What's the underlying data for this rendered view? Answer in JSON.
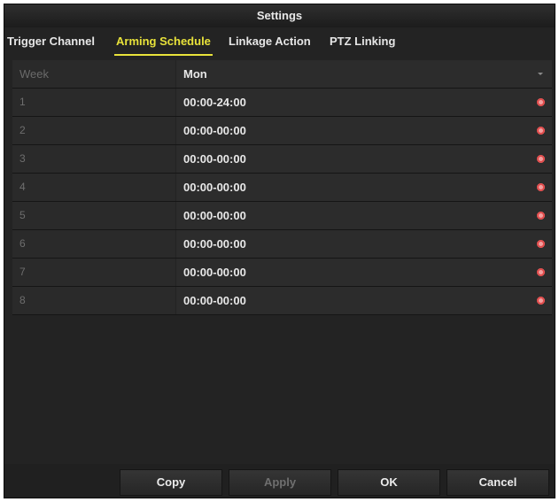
{
  "dialog": {
    "title": "Settings"
  },
  "tabs": [
    {
      "label": "Trigger Channel",
      "active": false
    },
    {
      "label": "Arming Schedule",
      "active": true
    },
    {
      "label": "Linkage Action",
      "active": false
    },
    {
      "label": "PTZ Linking",
      "active": false
    }
  ],
  "schedule": {
    "week_label": "Week",
    "week_value": "Mon",
    "rows": [
      {
        "index": "1",
        "time": "00:00-24:00"
      },
      {
        "index": "2",
        "time": "00:00-00:00"
      },
      {
        "index": "3",
        "time": "00:00-00:00"
      },
      {
        "index": "4",
        "time": "00:00-00:00"
      },
      {
        "index": "5",
        "time": "00:00-00:00"
      },
      {
        "index": "6",
        "time": "00:00-00:00"
      },
      {
        "index": "7",
        "time": "00:00-00:00"
      },
      {
        "index": "8",
        "time": "00:00-00:00"
      }
    ]
  },
  "buttons": {
    "copy": "Copy",
    "apply": "Apply",
    "ok": "OK",
    "cancel": "Cancel"
  },
  "icons": {
    "time": "clock-icon",
    "dropdown": "chevron-down-icon"
  },
  "colors": {
    "active_tab": "#e8e23a",
    "clock_icon": "#e14b4b"
  }
}
